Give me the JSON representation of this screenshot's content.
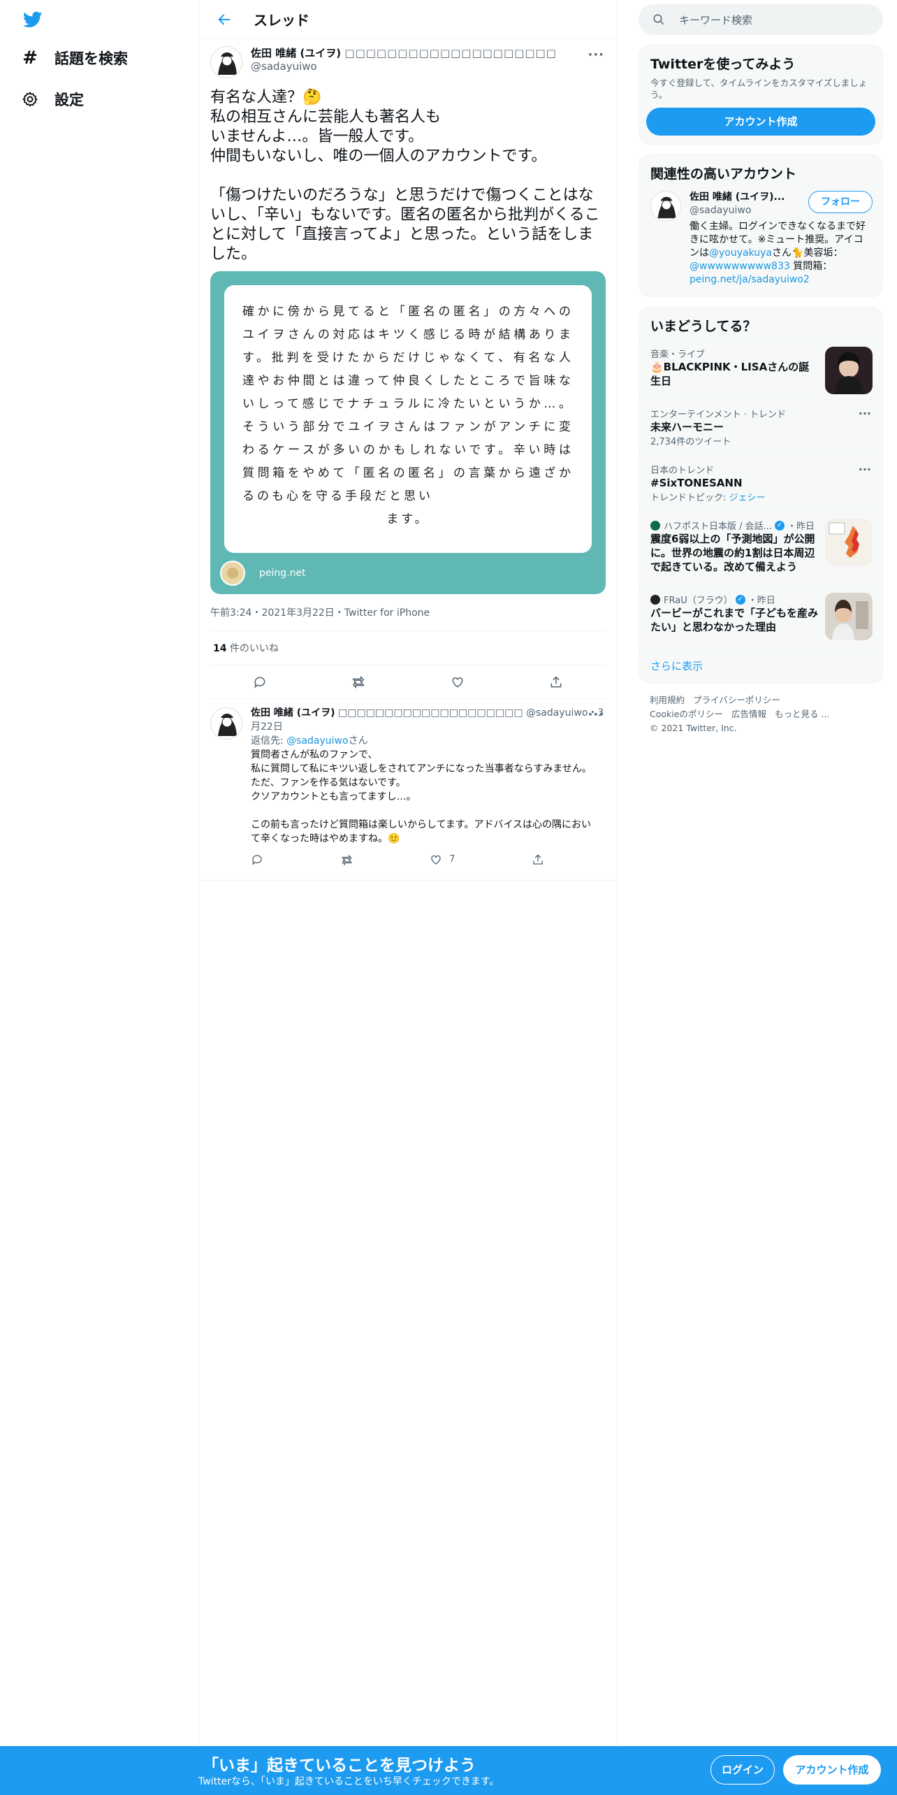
{
  "nav": {
    "explore": "話題を検索",
    "settings": "設定"
  },
  "header": {
    "title": "スレッド"
  },
  "tweet": {
    "name": "佐田 唯緒 (ユイヲ)",
    "name_glyphs": "□□□□□□□□□□□□□□□□□□□□",
    "handle": "@sadayuiwo",
    "body": "有名な人達？🤔\n私の相互さんに芸能人も著名人も\nいませんよ…。皆一般人です。\n仲間もいないし、唯の一個人のアカウントです。\n\n「傷つけたいのだろうな」と思うだけで傷つくことはないし、「辛い」もないです。匿名の匿名から批判がくることに対して「直接言ってよ」と思った。という話をしました。",
    "card_text": "確かに傍から見てると「匿名の匿名」の方々へのユイヲさんの対応はキツく感じる時が結構あります。批判を受けたからだけじゃなくて、有名な人達やお仲間とは違って仲良くしたところで旨味ないしって感じでナチュラルに冷たいというか…。そういう部分でユイヲさんはファンがアンチに変わるケースが多いのかもしれないです。辛い時は質問箱をやめて「匿名の匿名」の言葉から遠ざかるのも心を守る手段だと思い",
    "card_last": "ます。",
    "card_source": "peing.net",
    "meta": "午前3:24・2021年3月22日・Twitter for iPhone",
    "likes_count": "14",
    "likes_label": " 件のいいね"
  },
  "reply": {
    "name": "佐田 唯緒 (ユイヲ)",
    "name_glyphs": "□□□□□□□□□□□□□□□□□□□□",
    "handle_date": "@sadayuiwo・3月22日",
    "reply_to_label": "返信先: ",
    "reply_to_handle": "@sadayuiwo",
    "reply_to_suffix": "さん",
    "text": "質問者さんが私のファンで、\n私に質問して私にキツい返しをされてアンチになった当事者ならすみません。\nただ、ファンを作る気はないです。\nクソアカウントとも言ってますし…。\n\nこの前も言ったけど質問箱は楽しいからしてます。アドバイスは心の隅において辛くなった時はやめますね。🙂",
    "like_count": "7"
  },
  "search": {
    "placeholder": "キーワード検索"
  },
  "signup": {
    "title": "Twitterを使ってみよう",
    "desc": "今すぐ登録して、タイムラインをカスタマイズしましょう。",
    "button": "アカウント作成"
  },
  "relevant": {
    "title": "関連性の高いアカウント",
    "name": "佐田 唯緒 (ユイヲ)...",
    "handle": "@sadayuiwo",
    "follow": "フォロー",
    "bio_1": "働く主婦。ログインできなくなるまで好きに呟かせて。※ミュート推奨。アイコンは",
    "bio_link1": "@youyakuya",
    "bio_2": "さん🐈美容垢：",
    "bio_link2": "@wwwwwwwww833",
    "bio_3": " 質問箱：",
    "bio_link3": "peing.net/ja/sadayuiwo2"
  },
  "trends": {
    "title": "いまどうしてる？",
    "items": [
      {
        "cat": "音楽・ライブ",
        "title": "🎂BLACKPINK・LISAさんの誕生日",
        "sub": ""
      },
      {
        "cat": "エンターテインメント · トレンド",
        "title": "未来ハーモニー",
        "sub": "2,734件のツイート"
      },
      {
        "cat": "日本のトレンド",
        "title": "#SixTONESANN",
        "sub": "トレンドトピック: ",
        "sub_link": "ジェシー"
      },
      {
        "cat": "ハフポスト日本版 / 会話...",
        "cat_suffix": "・昨日",
        "title": "震度6弱以上の「予測地図」が公開に。世界の地震の約1割は日本周辺で起きている。改めて備えよう"
      },
      {
        "cat": "FRaU（フラウ）",
        "cat_suffix": "・昨日",
        "title": "バービーがこれまで「子どもを産みたい」と思わなかった理由"
      }
    ],
    "show_more": "さらに表示"
  },
  "footer": {
    "terms": "利用規約",
    "privacy": "プライバシーポリシー",
    "cookie": "Cookieのポリシー",
    "ads": "広告情報",
    "more": "もっと見る ...",
    "copyright": "© 2021 Twitter, Inc."
  },
  "bottombar": {
    "title": "「いま」起きていることを見つけよう",
    "sub": "Twitterなら、「いま」起きていることをいち早くチェックできます。",
    "login": "ログイン",
    "signup": "アカウント作成"
  },
  "colors": {
    "brand": "#1d9bf0",
    "card_bg": "#5fb8b3"
  }
}
